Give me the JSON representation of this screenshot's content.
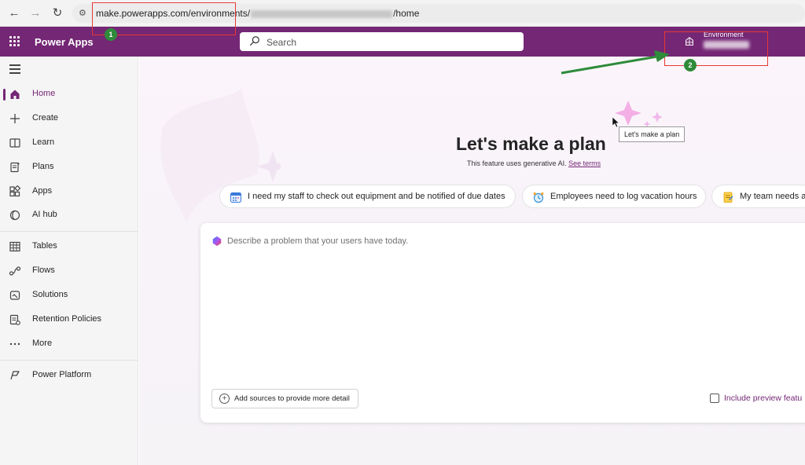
{
  "browser": {
    "url_host": "make.powerapps.com/environments/",
    "url_suffix": "/home",
    "back_icon": "arrow-left-icon",
    "forward_icon": "arrow-right-icon",
    "reload_icon": "reload-icon"
  },
  "header": {
    "app_title": "Power Apps",
    "search_placeholder": "Search",
    "environment_label": "Environment"
  },
  "sidebar": {
    "items": [
      {
        "label": "Home",
        "icon": "home-icon",
        "active": true
      },
      {
        "label": "Create",
        "icon": "plus-icon"
      },
      {
        "label": "Learn",
        "icon": "book-icon"
      },
      {
        "label": "Plans",
        "icon": "plans-icon"
      },
      {
        "label": "Apps",
        "icon": "apps-icon"
      },
      {
        "label": "AI hub",
        "icon": "ai-hub-icon"
      },
      {
        "label": "Tables",
        "icon": "table-icon"
      },
      {
        "label": "Flows",
        "icon": "flow-icon"
      },
      {
        "label": "Solutions",
        "icon": "solutions-icon"
      },
      {
        "label": "Retention Policies",
        "icon": "retention-icon"
      },
      {
        "label": "More",
        "icon": "more-icon"
      },
      {
        "label": "Power Platform",
        "icon": "power-platform-icon"
      }
    ]
  },
  "main": {
    "title": "Let's make a plan",
    "subtitle": "This feature uses generative AI.",
    "subtitle_link": "See terms",
    "tooltip": "Let's make a plan",
    "chips": [
      {
        "label": "I need my staff to check out equipment and be notified of due dates",
        "icon": "calendar-icon"
      },
      {
        "label": "Employees need to log vacation hours",
        "icon": "alarm-clock-icon"
      },
      {
        "label": "My team needs a",
        "icon": "notepad-icon"
      }
    ],
    "prompt_placeholder": "Describe a problem that your users have today.",
    "add_sources_label": "Add sources to provide more detail",
    "include_preview_label": "Include preview featu"
  },
  "annotations": [
    {
      "label": "1"
    },
    {
      "label": "2"
    }
  ],
  "colors": {
    "brand": "#742774",
    "annotation_red": "#e53935",
    "annotation_green": "#2e8b3a"
  }
}
